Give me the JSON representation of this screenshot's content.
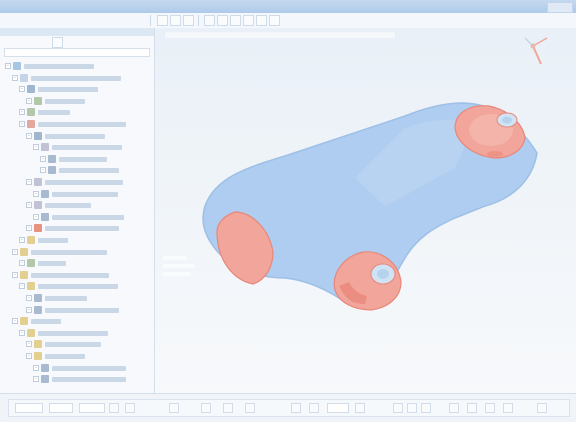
{
  "window": {
    "title": ""
  },
  "menu": {
    "items": [
      "",
      "",
      "",
      ""
    ]
  },
  "left_panel": {
    "tabs": [
      "",
      ""
    ],
    "root_label": "",
    "tree": [
      {
        "depth": 1,
        "icon": "root-node-icon",
        "w": 70
      },
      {
        "depth": 2,
        "icon": "file-icon",
        "w": 90
      },
      {
        "depth": 3,
        "icon": "gear-icon",
        "w": 60
      },
      {
        "depth": 4,
        "icon": "leaf-icon",
        "w": 40
      },
      {
        "depth": 3,
        "icon": "leaf-icon",
        "w": 32
      },
      {
        "depth": 3,
        "icon": "part-icon",
        "w": 88
      },
      {
        "depth": 4,
        "icon": "gear-icon",
        "w": 60
      },
      {
        "depth": 5,
        "icon": "group-icon",
        "w": 70
      },
      {
        "depth": 6,
        "icon": "mesh-icon",
        "w": 48
      },
      {
        "depth": 6,
        "icon": "mesh-icon",
        "w": 60
      },
      {
        "depth": 4,
        "icon": "group-icon",
        "w": 78
      },
      {
        "depth": 5,
        "icon": "mesh-icon",
        "w": 66
      },
      {
        "depth": 4,
        "icon": "group-icon",
        "w": 46
      },
      {
        "depth": 5,
        "icon": "mesh-icon",
        "w": 72
      },
      {
        "depth": 4,
        "icon": "load-icon",
        "w": 74
      },
      {
        "depth": 3,
        "icon": "folder-icon",
        "w": 30
      },
      {
        "depth": 2,
        "icon": "folder-icon",
        "w": 76
      },
      {
        "depth": 3,
        "icon": "leaf-icon",
        "w": 28
      },
      {
        "depth": 2,
        "icon": "folder-icon",
        "w": 78
      },
      {
        "depth": 3,
        "icon": "folder-icon",
        "w": 80
      },
      {
        "depth": 4,
        "icon": "mesh-icon",
        "w": 42
      },
      {
        "depth": 4,
        "icon": "mesh-icon",
        "w": 74
      },
      {
        "depth": 2,
        "icon": "folder-icon",
        "w": 30
      },
      {
        "depth": 3,
        "icon": "folder-icon",
        "w": 70
      },
      {
        "depth": 4,
        "icon": "folder-icon",
        "w": 56
      },
      {
        "depth": 4,
        "icon": "folder-icon",
        "w": 40
      },
      {
        "depth": 5,
        "icon": "mesh-icon",
        "w": 74
      },
      {
        "depth": 5,
        "icon": "mesh-icon",
        "w": 74
      }
    ],
    "footer_label": ""
  },
  "viewport": {
    "info": ""
  },
  "status": {
    "fields": [
      "",
      "",
      "",
      ""
    ]
  },
  "colors": {
    "part_blue": "#aecdf0",
    "part_blue_dark": "#9ebfe6",
    "part_red": "#f2a59a",
    "part_red_dark": "#e8877a",
    "accent": "#7ea6d2"
  }
}
